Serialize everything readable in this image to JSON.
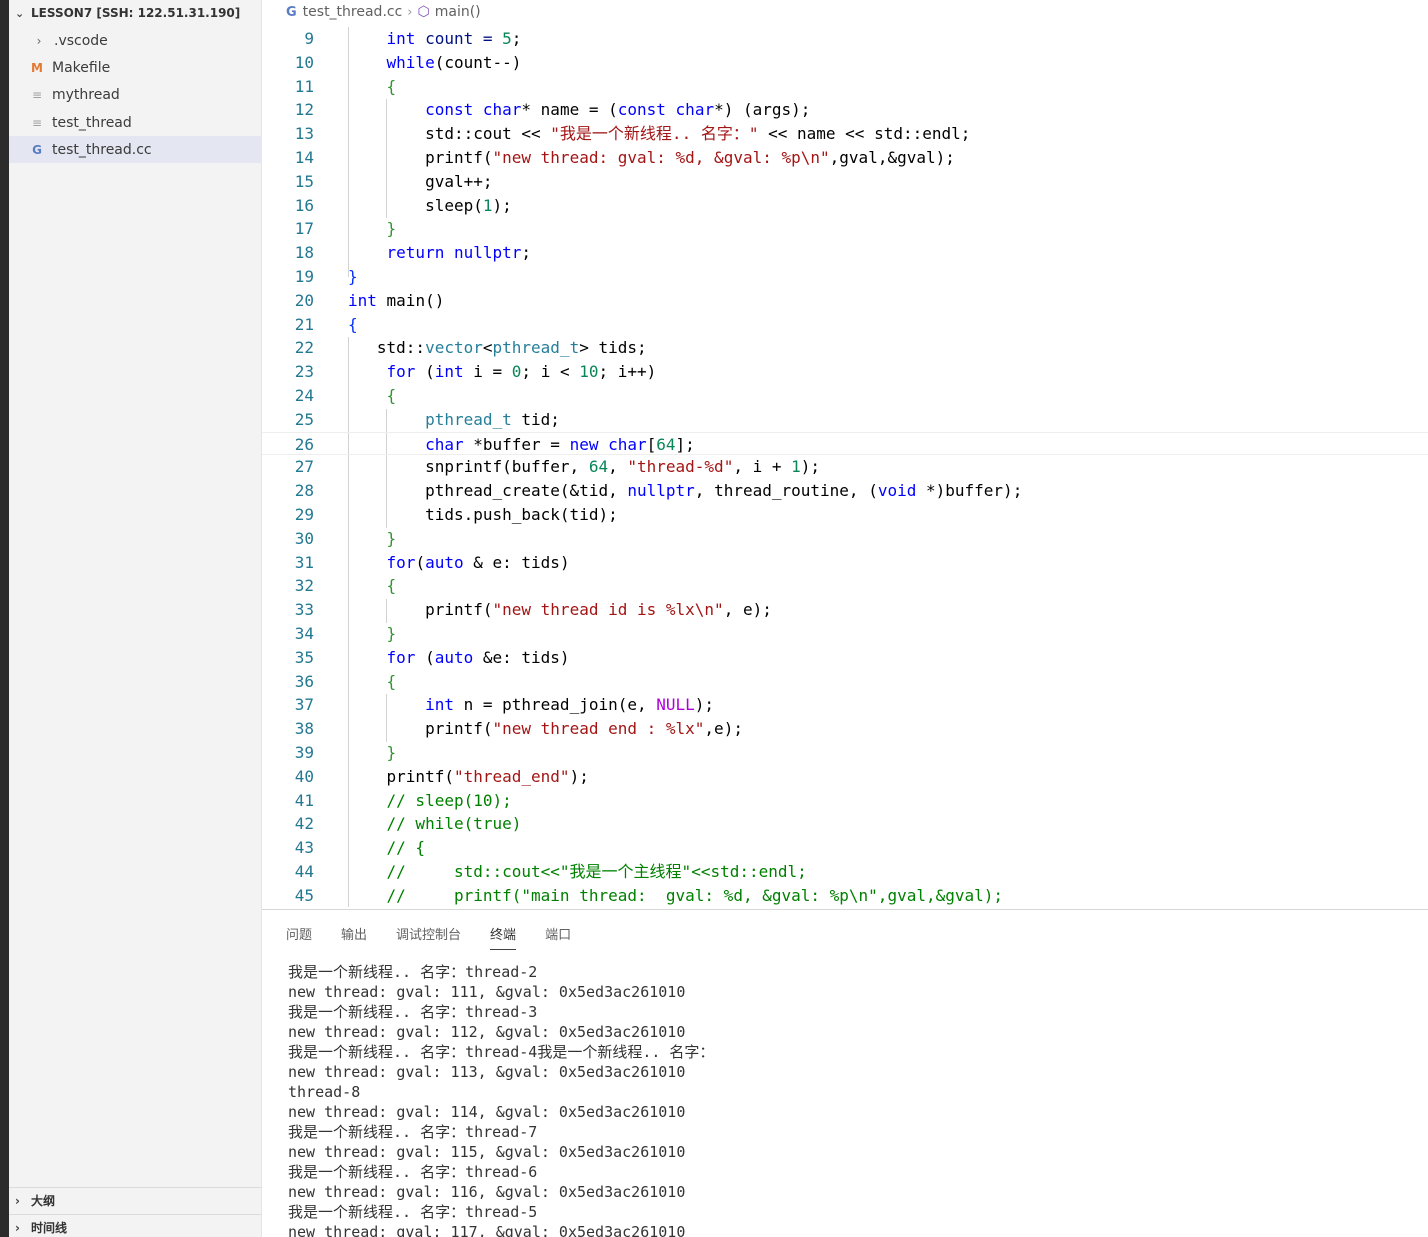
{
  "sidebar": {
    "header": "LESSON7 [SSH: 122.51.31.190]",
    "items": [
      {
        "label": ".vscode",
        "icon": "chevron-right-icon"
      },
      {
        "label": "Makefile",
        "icon": "makefile-icon"
      },
      {
        "label": "mythread",
        "icon": "file-lines-icon"
      },
      {
        "label": "test_thread",
        "icon": "file-lines-icon"
      },
      {
        "label": "test_thread.cc",
        "icon": "cpp-file-icon"
      }
    ],
    "outline": "大纲",
    "timeline": "时间线"
  },
  "breadcrumb": {
    "file": "test_thread.cc",
    "symbol": "main()"
  },
  "editor": {
    "line_numbers": [
      "9",
      "10",
      "11",
      "12",
      "13",
      "14",
      "15",
      "16",
      "17",
      "18",
      "19",
      "20",
      "21",
      "22",
      "23",
      "24",
      "25",
      "26",
      "27",
      "28",
      "29",
      "30",
      "31",
      "32",
      "33",
      "34",
      "35",
      "36",
      "37",
      "38",
      "39",
      "40",
      "41",
      "42",
      "43",
      "44",
      "45"
    ]
  },
  "panel": {
    "tabs": [
      "问题",
      "输出",
      "调试控制台",
      "终端",
      "端口"
    ],
    "active_tab": "终端",
    "terminal_lines": [
      "我是一个新线程.. 名字：thread-2",
      "new thread: gval: 111, &gval: 0x5ed3ac261010",
      "我是一个新线程.. 名字：thread-3",
      "new thread: gval: 112, &gval: 0x5ed3ac261010",
      "我是一个新线程.. 名字：thread-4我是一个新线程.. 名字：",
      "new thread: gval: 113, &gval: 0x5ed3ac261010",
      "thread-8",
      "new thread: gval: 114, &gval: 0x5ed3ac261010",
      "我是一个新线程.. 名字：thread-7",
      "new thread: gval: 115, &gval: 0x5ed3ac261010",
      "我是一个新线程.. 名字：thread-6",
      "new thread: gval: 116, &gval: 0x5ed3ac261010",
      "我是一个新线程.. 名字：thread-5",
      "new thread: gval: 117, &gval: 0x5ed3ac261010"
    ]
  },
  "code_lines": {
    "l9": [
      "    ",
      "int",
      " count = ",
      "5",
      ";"
    ],
    "l10": [
      "    ",
      "while",
      "(count--)"
    ],
    "l11": [
      "    ",
      "{"
    ],
    "l12": [
      "        ",
      "const",
      " ",
      "char",
      "* name = (",
      "const",
      " ",
      "char",
      "*) (args);"
    ],
    "l13": [
      "        std::cout << ",
      "\"我是一个新线程.. 名字：\"",
      " << name << std::endl;"
    ],
    "l14": [
      "        printf(",
      "\"new thread: gval: %d, &gval: %p\\n\"",
      ",gval,&gval);"
    ],
    "l15": [
      "        gval++;"
    ],
    "l16": [
      "        sleep(",
      "1",
      ");"
    ],
    "l17": [
      "    ",
      "}"
    ],
    "l18": [
      "    ",
      "return",
      " ",
      "nullptr",
      ";"
    ],
    "l19": [
      "}"
    ],
    "l20": [
      "int",
      " main()"
    ],
    "l21": [
      "{"
    ],
    "l22": [
      "   std::",
      "vector",
      "<",
      "pthread_t",
      "> tids;"
    ],
    "l23": [
      "    ",
      "for",
      " (",
      "int",
      " i = ",
      "0",
      "; i < ",
      "10",
      "; i++)"
    ],
    "l24": [
      "    ",
      "{"
    ],
    "l25": [
      "        ",
      "pthread_t",
      " tid;"
    ],
    "l26": [
      "        ",
      "char",
      " *buffer = ",
      "new",
      " ",
      "char",
      "[",
      "64",
      "];"
    ],
    "l27": [
      "        snprintf(buffer, ",
      "64",
      ", ",
      "\"thread-%d\"",
      ", i + ",
      "1",
      ");"
    ],
    "l28": [
      "        pthread_create(&tid, ",
      "nullptr",
      ", thread_routine, (",
      "void",
      " *)buffer);"
    ],
    "l29": [
      "        tids.push_back(tid);"
    ],
    "l30": [
      "    ",
      "}"
    ],
    "l31": [
      "    ",
      "for",
      "(",
      "auto",
      " & e: tids)"
    ],
    "l32": [
      "    ",
      "{"
    ],
    "l33": [
      "        printf(",
      "\"new thread id is %lx\\n\"",
      ", e);"
    ],
    "l34": [
      "    ",
      "}"
    ],
    "l35": [
      "    ",
      "for",
      " (",
      "auto",
      " &e: tids)"
    ],
    "l36": [
      "    ",
      "{"
    ],
    "l37": [
      "        ",
      "int",
      " n = pthread_join(e, ",
      "NULL",
      ");"
    ],
    "l38": [
      "        printf(",
      "\"new thread end : %lx\"",
      ",e);"
    ],
    "l39": [
      "    ",
      "}"
    ],
    "l40": [
      "    printf(",
      "\"thread_end\"",
      ");"
    ],
    "l41": [
      "    ",
      "// sleep(10);"
    ],
    "l42": [
      "    ",
      "// while(true)"
    ],
    "l43": [
      "    ",
      "// {"
    ],
    "l44": [
      "    ",
      "//     std::cout<<\"我是一个主线程\"<<std::endl;"
    ],
    "l45": [
      "    ",
      "//     printf(\"main thread:  gval: %d, &gval: %p\\n\",gval,&gval);"
    ]
  }
}
